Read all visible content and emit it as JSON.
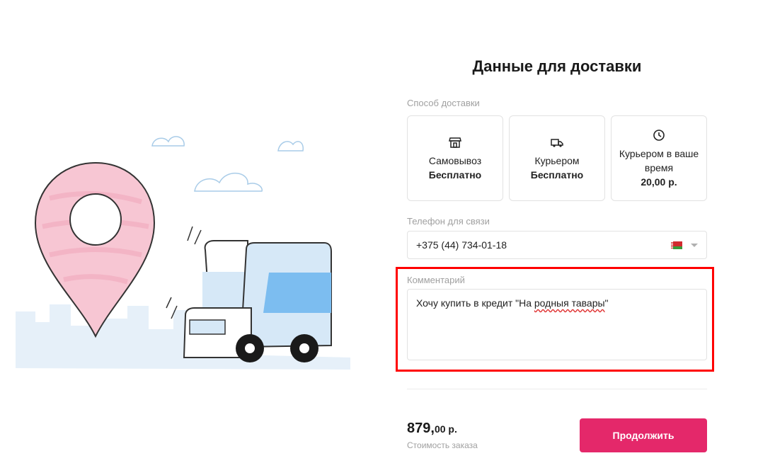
{
  "page": {
    "title": "Данные для доставки"
  },
  "delivery": {
    "label": "Способ доставки",
    "options": [
      {
        "icon": "store-icon",
        "name": "Самовывоз",
        "price": "Бесплатно"
      },
      {
        "icon": "truck-icon",
        "name": "Курьером",
        "price": "Бесплатно"
      },
      {
        "icon": "clock-icon",
        "name": "Курьером в ваше время",
        "price": "20,00 р."
      }
    ]
  },
  "phone": {
    "label": "Телефон для связи",
    "value": "+375 (44) 734-01-18",
    "country_flag": "belarus-flag-icon"
  },
  "comment": {
    "label": "Комментарий",
    "value_before": "Хочу купить в кредит \"На ",
    "value_misspelled": "родныя тавары",
    "value_after": "\""
  },
  "order": {
    "amount_main": "879,",
    "amount_cents": "00 р.",
    "label": "Стоимость заказа"
  },
  "actions": {
    "continue_label": "Продолжить"
  },
  "colors": {
    "accent": "#e4286a",
    "highlight": "#ff0000",
    "pin": "#f7c6d3",
    "truck_window": "#7cbdf0",
    "truck_body": "#d6e8f7"
  }
}
